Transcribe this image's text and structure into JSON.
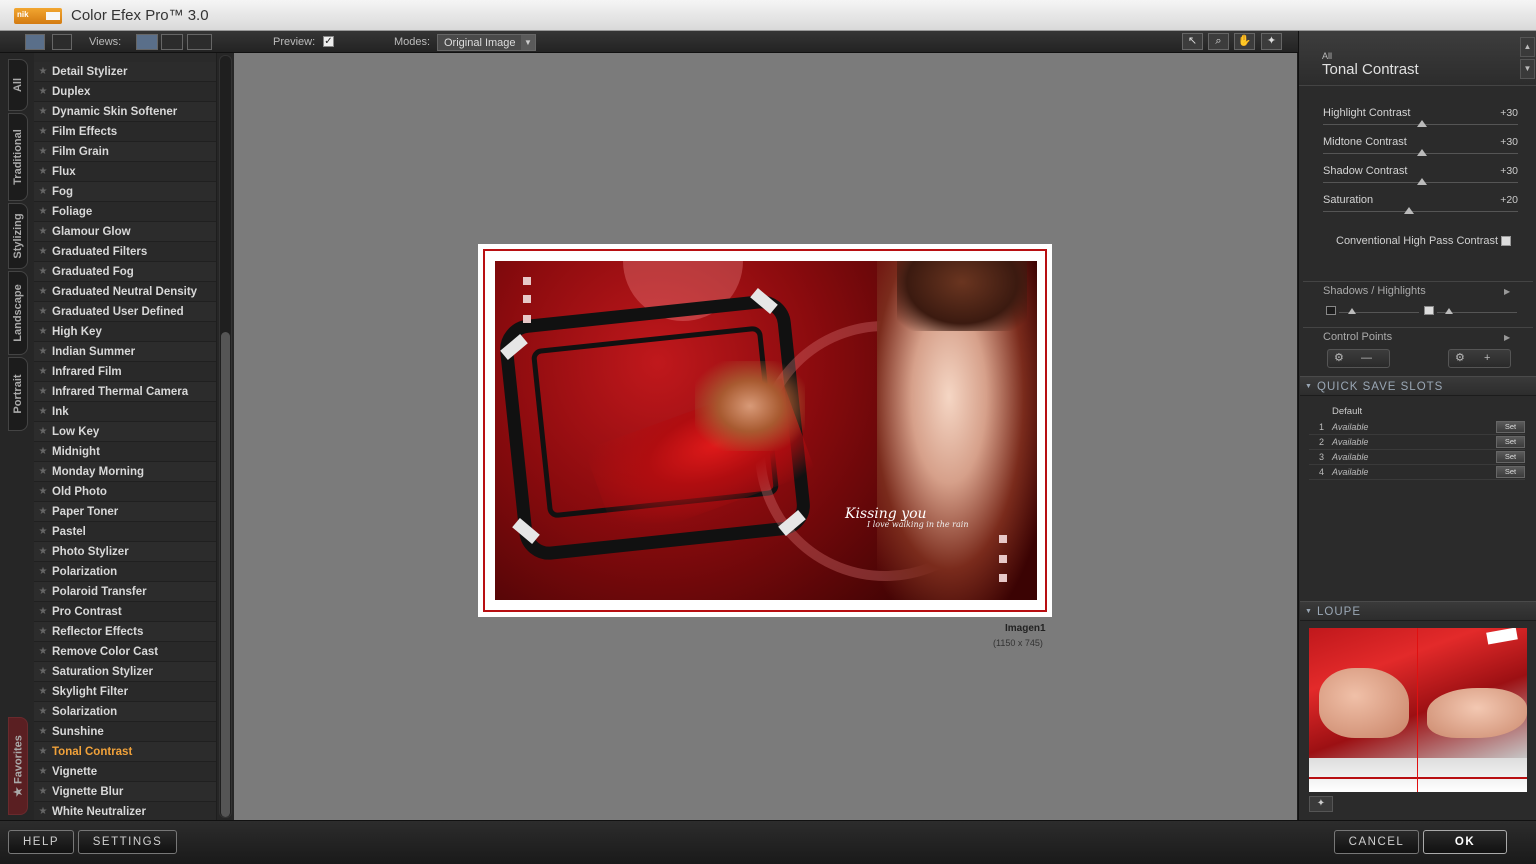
{
  "window": {
    "title": "Color Efex Pro™ 3.0",
    "logo_text": "nik"
  },
  "toolbar": {
    "views_label": "Views:",
    "preview_label": "Preview:",
    "preview_check": "✓",
    "modes_label": "Modes:",
    "mode_value": "Original Image",
    "dropdown_glyph": "▼",
    "tool_select": "↖",
    "tool_zoom": "⌕",
    "tool_hand": "✋",
    "tool_pin": "✦"
  },
  "category_tabs": [
    "All",
    "Traditional",
    "Stylizing",
    "Landscape",
    "Portrait"
  ],
  "favorites_tab": "★ Favorites",
  "filters": {
    "star": "★",
    "items": [
      "Detail Stylizer",
      "Duplex",
      "Dynamic Skin Softener",
      "Film Effects",
      "Film Grain",
      "Flux",
      "Fog",
      "Foliage",
      "Glamour Glow",
      "Graduated Filters",
      "Graduated Fog",
      "Graduated Neutral Density",
      "Graduated User Defined",
      "High Key",
      "Indian Summer",
      "Infrared Film",
      "Infrared Thermal Camera",
      "Ink",
      "Low Key",
      "Midnight",
      "Monday Morning",
      "Old Photo",
      "Paper Toner",
      "Pastel",
      "Photo Stylizer",
      "Polarization",
      "Polaroid Transfer",
      "Pro Contrast",
      "Reflector Effects",
      "Remove Color Cast",
      "Saturation Stylizer",
      "Skylight Filter",
      "Solarization",
      "Sunshine",
      "Tonal Contrast",
      "Vignette",
      "Vignette Blur",
      "White Neutralizer"
    ],
    "selected": "Tonal Contrast"
  },
  "preview": {
    "image_name": "Imagen1",
    "image_size": "(1150 x 745)",
    "script_title": "Kissing you",
    "script_sub": "I love walking in the rain"
  },
  "panel": {
    "category": "All",
    "filter_name": "Tonal Contrast",
    "up_glyph": "▲",
    "down_glyph": "▼",
    "right_glyph": "▶",
    "sliders": [
      {
        "label": "Highlight Contrast",
        "value": "+30"
      },
      {
        "label": "Midtone Contrast",
        "value": "+30"
      },
      {
        "label": "Shadow Contrast",
        "value": "+30"
      },
      {
        "label": "Saturation",
        "value": "+20"
      }
    ],
    "checkbox_label": "Conventional High Pass Contrast",
    "shadows_highlights": "Shadows / Highlights",
    "control_points": "Control Points",
    "cp_minus": "—",
    "cp_plus": "+",
    "quick_save_title": "QUICK SAVE SLOTS",
    "default_slot": "Default",
    "slots": [
      {
        "num": "1",
        "label": "Available",
        "button": "Set"
      },
      {
        "num": "2",
        "label": "Available",
        "button": "Set"
      },
      {
        "num": "3",
        "label": "Available",
        "button": "Set"
      },
      {
        "num": "4",
        "label": "Available",
        "button": "Set"
      }
    ],
    "loupe_title": "LOUPE",
    "pin_glyph": "✦"
  },
  "bottom": {
    "help": "HELP",
    "settings": "SETTINGS",
    "cancel": "CANCEL",
    "ok": "OK"
  }
}
